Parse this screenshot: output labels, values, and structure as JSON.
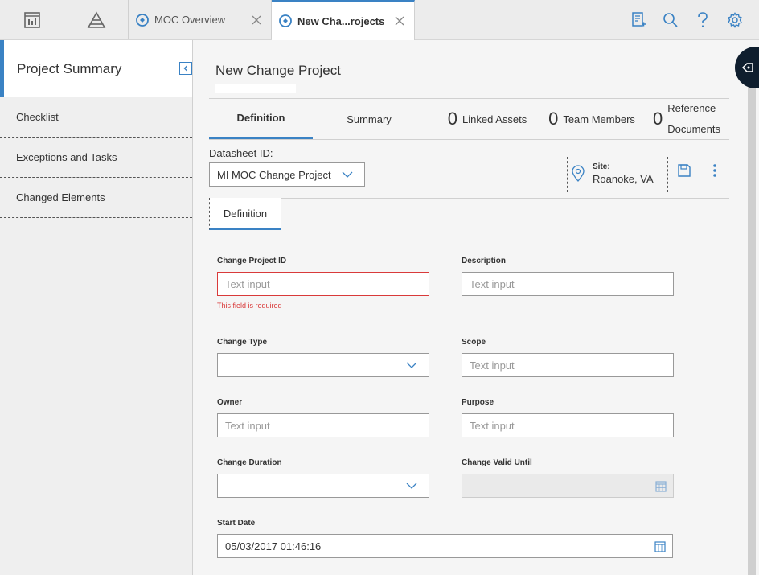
{
  "topbar": {
    "tabs": [
      {
        "label": "MOC Overview",
        "icon": "moc-icon"
      },
      {
        "label": "New Cha...rojects",
        "icon": "moc-icon"
      }
    ],
    "icons": [
      "dashboard-icon",
      "pyramid-icon",
      "report-icon",
      "search-icon",
      "help-icon",
      "gear-icon"
    ]
  },
  "sidebar": {
    "title": "Project Summary",
    "items": [
      {
        "label": "Checklist"
      },
      {
        "label": "Exceptions and Tasks"
      },
      {
        "label": "Changed Elements"
      }
    ]
  },
  "main": {
    "title": "New Change Project",
    "tabs": {
      "definition": "Definition",
      "summary": "Summary",
      "linked_assets": {
        "count": "0",
        "label": "Linked Assets"
      },
      "team_members": {
        "count": "0",
        "label": "Team Members"
      },
      "reference_documents": {
        "count": "0",
        "label_line1": "Reference",
        "label_line2": "Documents"
      }
    },
    "datasheet": {
      "label": "Datasheet ID:",
      "value": "MI MOC Change Project"
    },
    "site": {
      "label": "Site:",
      "value": "Roanoke, VA"
    },
    "subtab": "Definition"
  },
  "form": {
    "change_project_id": {
      "label": "Change Project ID",
      "placeholder": "Text input",
      "error": "This field is required"
    },
    "description": {
      "label": "Description",
      "placeholder": "Text input"
    },
    "change_type": {
      "label": "Change Type",
      "value": ""
    },
    "scope": {
      "label": "Scope",
      "placeholder": "Text input"
    },
    "owner": {
      "label": "Owner",
      "placeholder": "Text input"
    },
    "purpose": {
      "label": "Purpose",
      "placeholder": "Text input"
    },
    "change_duration": {
      "label": "Change Duration",
      "value": ""
    },
    "change_valid_until": {
      "label": "Change Valid Until",
      "value": ""
    },
    "start_date": {
      "label": "Start Date",
      "value": "05/03/2017 01:46:16"
    }
  },
  "colors": {
    "accent": "#3a82c4",
    "error": "#d93a3a",
    "icon": "#3a82c4"
  }
}
